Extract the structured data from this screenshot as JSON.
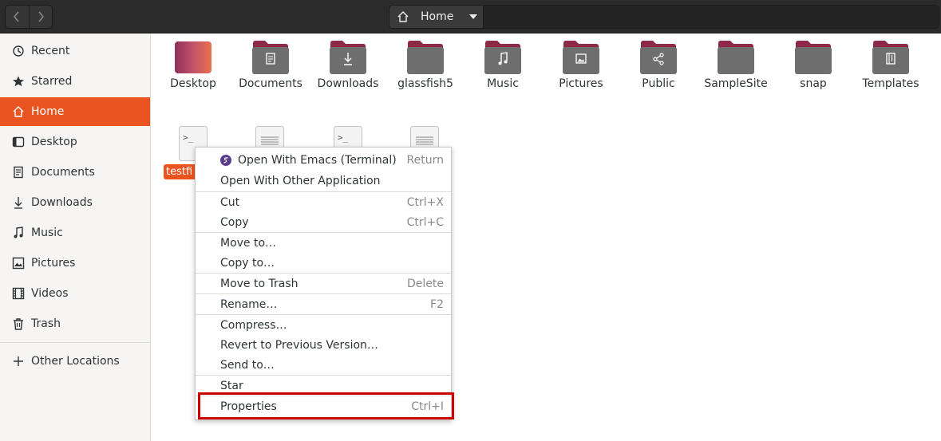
{
  "header": {
    "path_home_label": "Home"
  },
  "sidebar": {
    "items": [
      {
        "label": "Recent",
        "icon": "clock-icon"
      },
      {
        "label": "Starred",
        "icon": "star-icon"
      },
      {
        "label": "Home",
        "icon": "home-icon"
      },
      {
        "label": "Desktop",
        "icon": "desktop-icon"
      },
      {
        "label": "Documents",
        "icon": "document-icon"
      },
      {
        "label": "Downloads",
        "icon": "download-icon"
      },
      {
        "label": "Music",
        "icon": "music-icon"
      },
      {
        "label": "Pictures",
        "icon": "picture-icon"
      },
      {
        "label": "Videos",
        "icon": "video-icon"
      },
      {
        "label": "Trash",
        "icon": "trash-icon"
      }
    ],
    "other_locations": "Other Locations",
    "active": "Home"
  },
  "folders": [
    {
      "label": "Desktop",
      "emblem": "none"
    },
    {
      "label": "Documents",
      "emblem": "document"
    },
    {
      "label": "Downloads",
      "emblem": "download"
    },
    {
      "label": "glassfish5",
      "emblem": "none"
    },
    {
      "label": "Music",
      "emblem": "music"
    },
    {
      "label": "Pictures",
      "emblem": "picture"
    },
    {
      "label": "Public",
      "emblem": "share"
    },
    {
      "label": "SampleSite",
      "emblem": "none"
    },
    {
      "label": "snap",
      "emblem": "none"
    },
    {
      "label": "Templates",
      "emblem": "template"
    }
  ],
  "files": {
    "selected_label": "testfi"
  },
  "context_menu": {
    "items": [
      {
        "label": "Open With Emacs (Terminal)",
        "accel": "Return"
      },
      {
        "label": "Open With Other Application",
        "accel": ""
      },
      {
        "label": "Cut",
        "accel": "Ctrl+X"
      },
      {
        "label": "Copy",
        "accel": "Ctrl+C"
      },
      {
        "label": "Move to…",
        "accel": ""
      },
      {
        "label": "Copy to…",
        "accel": ""
      },
      {
        "label": "Move to Trash",
        "accel": "Delete"
      },
      {
        "label": "Rename…",
        "accel": "F2"
      },
      {
        "label": "Compress…",
        "accel": ""
      },
      {
        "label": "Revert to Previous Version…",
        "accel": ""
      },
      {
        "label": "Send to…",
        "accel": ""
      },
      {
        "label": "Star",
        "accel": ""
      },
      {
        "label": "Properties",
        "accel": "Ctrl+I"
      }
    ],
    "highlighted": "Properties",
    "highlight_color": "#cc0000"
  },
  "colors": {
    "accent": "#e95420",
    "folder_tab": "#8e2a48",
    "folder_body": "#6e6e6e"
  }
}
